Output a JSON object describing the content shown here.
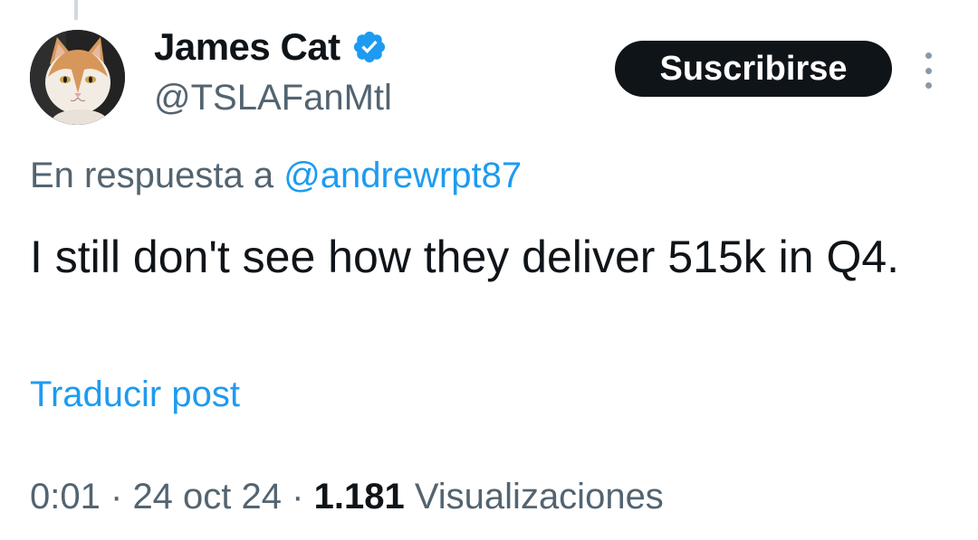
{
  "author": {
    "name": "James Cat",
    "handle": "@TSLAFanMtl",
    "verified_color": "#1d9bf0"
  },
  "subscribe_label": "Suscribirse",
  "reply": {
    "prefix": "En respuesta a",
    "mention": "@andrewrpt87"
  },
  "post": {
    "text": "I still don't see how they deliver 515k in Q4."
  },
  "translate_label": "Traducir post",
  "meta": {
    "time": "0:01",
    "separator": "·",
    "date": "24 oct 24",
    "views_count": "1.181",
    "views_label": "Visualizaciones"
  },
  "icons": {
    "verified": "verified-badge-icon",
    "more": "more-options-icon"
  },
  "colors": {
    "text": "#0f1419",
    "secondary": "#536471",
    "accent": "#1d9bf0",
    "button": "#0f1419"
  }
}
